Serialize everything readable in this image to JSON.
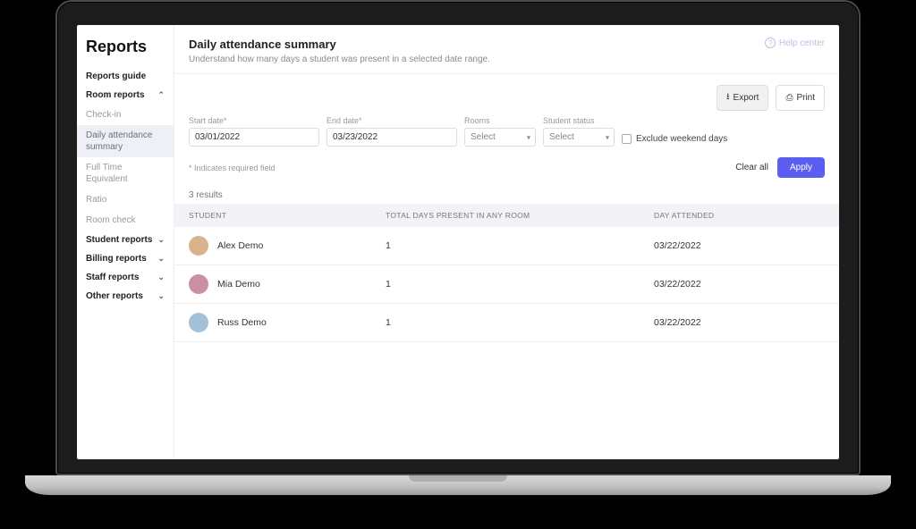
{
  "brand": "Reports",
  "help_label": "Help center",
  "sidebar": {
    "guide": "Reports guide",
    "sections": [
      {
        "label": "Room reports",
        "expanded": true
      },
      {
        "label": "Student reports",
        "expanded": false
      },
      {
        "label": "Billing reports",
        "expanded": false
      },
      {
        "label": "Staff reports",
        "expanded": false
      },
      {
        "label": "Other reports",
        "expanded": false
      }
    ],
    "room_items": [
      {
        "label": "Check-in",
        "active": false
      },
      {
        "label": "Daily attendance summary",
        "active": true
      },
      {
        "label": "Full Time Equivalent",
        "active": false
      },
      {
        "label": "Ratio",
        "active": false
      },
      {
        "label": "Room check",
        "active": false
      }
    ]
  },
  "header": {
    "title": "Daily attendance summary",
    "description": "Understand how many days a student was present in a selected date range."
  },
  "toolbar": {
    "export": "Export",
    "print": "Print"
  },
  "filters": {
    "start_label": "Start date*",
    "start_value": "03/01/2022",
    "end_label": "End date*",
    "end_value": "03/23/2022",
    "rooms_label": "Rooms",
    "rooms_placeholder": "Select",
    "status_label": "Student status",
    "status_placeholder": "Select",
    "exclude_label": "Exclude weekend days",
    "required_note": "* Indicates required field",
    "clear": "Clear all",
    "apply": "Apply"
  },
  "results": {
    "count_label": "3 results",
    "columns": {
      "student": "STUDENT",
      "days": "TOTAL DAYS PRESENT IN ANY ROOM",
      "date": "DAY ATTENDED"
    },
    "rows": [
      {
        "name": "Alex Demo",
        "days": "1",
        "date": "03/22/2022",
        "avatar_bg": "#d9b38c"
      },
      {
        "name": "Mia Demo",
        "days": "1",
        "date": "03/22/2022",
        "avatar_bg": "#c98fa3"
      },
      {
        "name": "Russ Demo",
        "days": "1",
        "date": "03/22/2022",
        "avatar_bg": "#a3c2d9"
      }
    ]
  }
}
